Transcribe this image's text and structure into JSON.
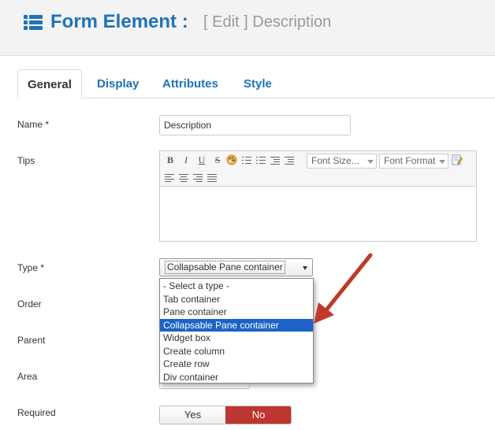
{
  "header": {
    "title": "Form Element :",
    "subtitle": "[ Edit ] Description",
    "icon": "list-icon",
    "accent": "#1f73b7"
  },
  "tabs": [
    {
      "label": "General",
      "active": true
    },
    {
      "label": "Display",
      "active": false
    },
    {
      "label": "Attributes",
      "active": false
    },
    {
      "label": "Style",
      "active": false
    }
  ],
  "fields": {
    "name": {
      "label": "Name *",
      "value": "Description"
    },
    "tips": {
      "label": "Tips",
      "toolbar": {
        "bold": "B",
        "italic": "I",
        "underline": "U",
        "strikethrough": "S",
        "font_size": "Font Size...",
        "font_format": "Font Format"
      }
    },
    "type": {
      "label": "Type *",
      "selected": "Collapsable Pane container",
      "options": [
        "- Select a type -",
        "Tab container",
        "Pane container",
        "Collapsable Pane container",
        "Widget box",
        "Create column",
        "Create row",
        "Div container"
      ],
      "highlighted_index": 3
    },
    "order": {
      "label": "Order"
    },
    "parent": {
      "label": "Parent"
    },
    "area": {
      "label": "Area"
    },
    "required": {
      "label": "Required",
      "yes": "Yes",
      "no": "No",
      "selected": "No",
      "no_color": "#bd362f"
    }
  },
  "annotation": {
    "arrow_color": "#c0392b"
  }
}
